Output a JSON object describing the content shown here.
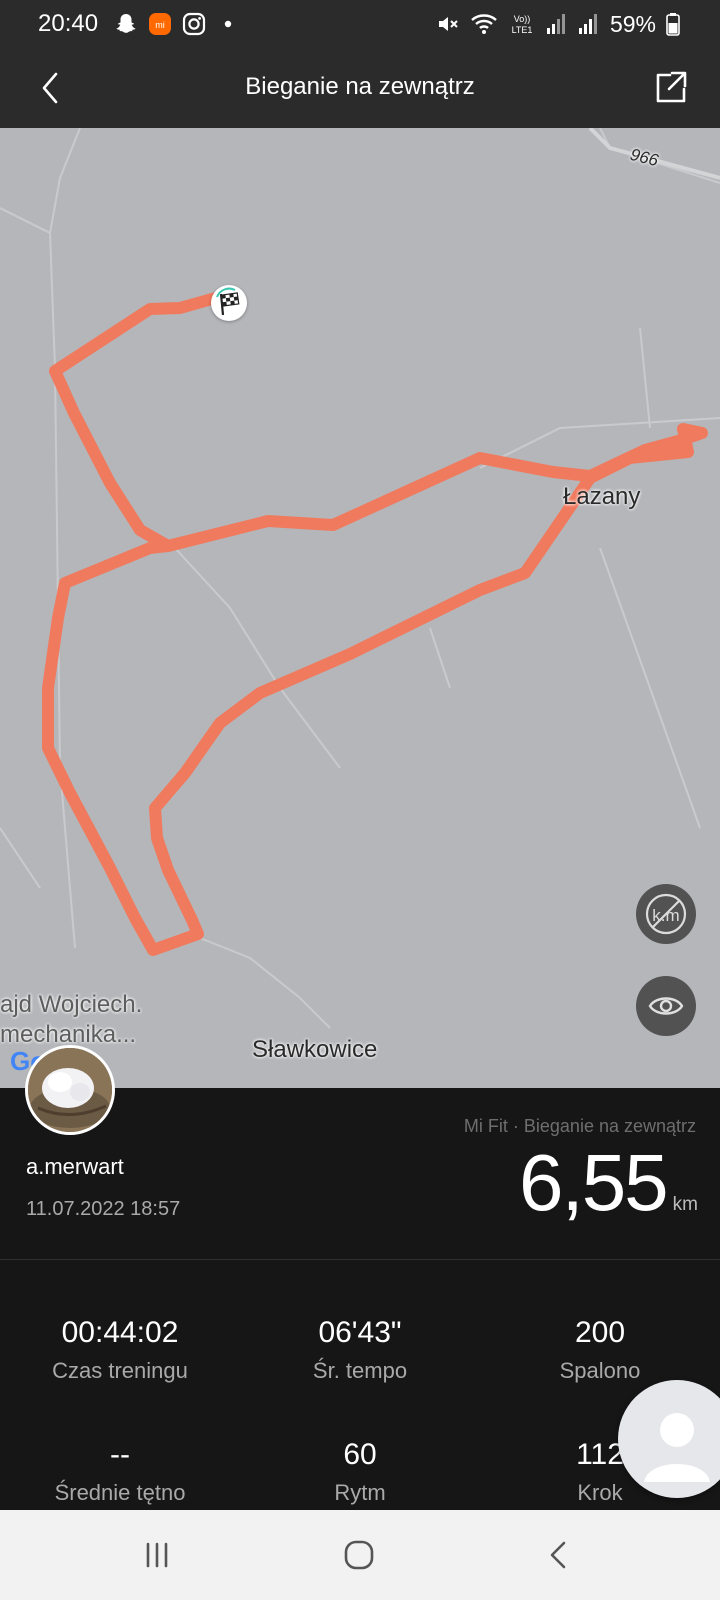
{
  "status_bar": {
    "time": "20:40",
    "battery": "59%",
    "left_icons": [
      "snapchat-icon",
      "mi-icon",
      "instagram-icon",
      "dot-icon"
    ],
    "right_icons": [
      "mute-icon",
      "wifi-icon",
      "volte-icon",
      "signal-icon",
      "signal-icon",
      "battery-icon"
    ],
    "volte_text_top": "Vo))",
    "volte_text_bottom": "LTE1"
  },
  "header": {
    "title": "Bieganie na zewnątrz",
    "back_icon": "chevron-left-icon",
    "share_icon": "share-icon"
  },
  "map": {
    "labels": {
      "town_1": "Łazany",
      "town_2": "Sławkowice",
      "road_number": "966",
      "poi": "ajd Wojciech.\nmechanika..."
    },
    "route_color": "#f07a5e",
    "background_color": "#b5b6ba",
    "finish_icon": "checkered-flag-icon",
    "controls": [
      "km-hidden-icon",
      "eye-icon"
    ],
    "google_logo_text": "Google"
  },
  "workout": {
    "username": "a.merwart",
    "datetime": "11.07.2022 18:57",
    "source": "Mi Fit · Bieganie na zewnątrz",
    "distance": "6,55",
    "distance_unit": "km"
  },
  "stats": [
    {
      "value": "00:44:02",
      "label": "Czas treningu"
    },
    {
      "value": "06'43\"",
      "label": "Śr. tempo"
    },
    {
      "value": "200",
      "label": "Spalono"
    },
    {
      "value": "--",
      "label": "Średnie tętno"
    },
    {
      "value": "60",
      "label": "Rytm"
    },
    {
      "value": "112",
      "label": "Krok"
    }
  ],
  "nav_bar": {
    "buttons": [
      "recent-apps-icon",
      "home-icon",
      "back-icon"
    ]
  }
}
